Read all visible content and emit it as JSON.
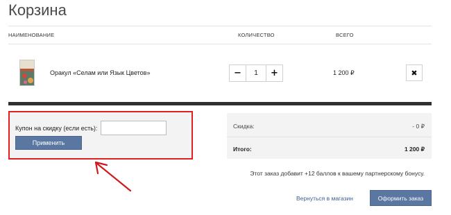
{
  "page_title": "Корзина",
  "table": {
    "col_name": "НАИМЕНОВАНИЕ",
    "col_qty": "КОЛИЧЕСТВО",
    "col_total": "ВСЕГО"
  },
  "item": {
    "name": "Оракул «Селам или Язык Цветов»",
    "quantity": "1",
    "minus": "−",
    "plus": "+",
    "price": "1 200 ₽",
    "remove": "✖"
  },
  "coupon": {
    "label": "Купон на скидку (если есть):",
    "value": "",
    "apply_label": "Применить"
  },
  "summary": {
    "discount_label": "Скидка:",
    "discount_value": "- 0 ₽",
    "total_label": "Итого:",
    "total_value": "1 200 ₽"
  },
  "bonus_text": "Этот заказ добавит +12 баллов к вашему партнерскому бонусу.",
  "actions": {
    "back_label": "Вернуться в магазин",
    "checkout_label": "Оформить заказ"
  },
  "colors": {
    "button": "#5a77a1",
    "highlight": "#e02020",
    "divider": "#2f2f2f"
  },
  "icons": {
    "remove": "close-icon",
    "annotation": "arrow-icon"
  }
}
